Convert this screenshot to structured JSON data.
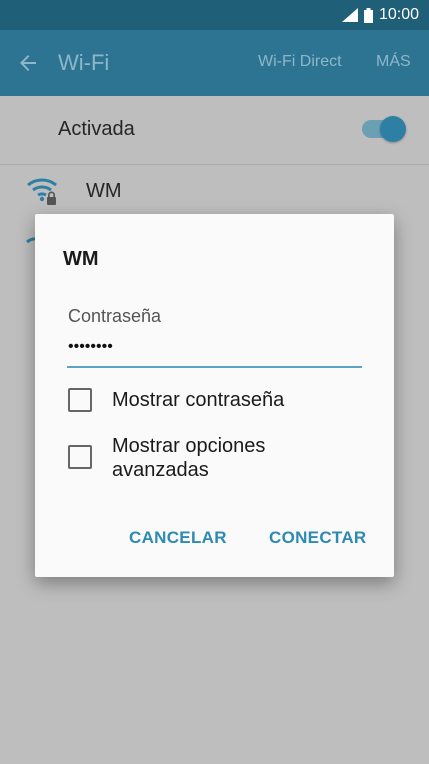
{
  "status_bar": {
    "time": "10:00"
  },
  "app_bar": {
    "title": "Wi-Fi",
    "wifi_direct": "Wi-Fi Direct",
    "more": "MÁS"
  },
  "settings": {
    "toggle_row_label": "Activada",
    "network_name": "WM"
  },
  "dialog": {
    "title": "WM",
    "password_label": "Contraseña",
    "password_value": "••••••••",
    "show_password": "Mostrar contraseña",
    "show_advanced": "Mostrar opciones avanzadas",
    "cancel": "CANCELAR",
    "connect": "CONECTAR"
  },
  "colors": {
    "app_bar": "#2d7493",
    "status_bar": "#1f5f78",
    "accent": "#2d8ab0"
  }
}
